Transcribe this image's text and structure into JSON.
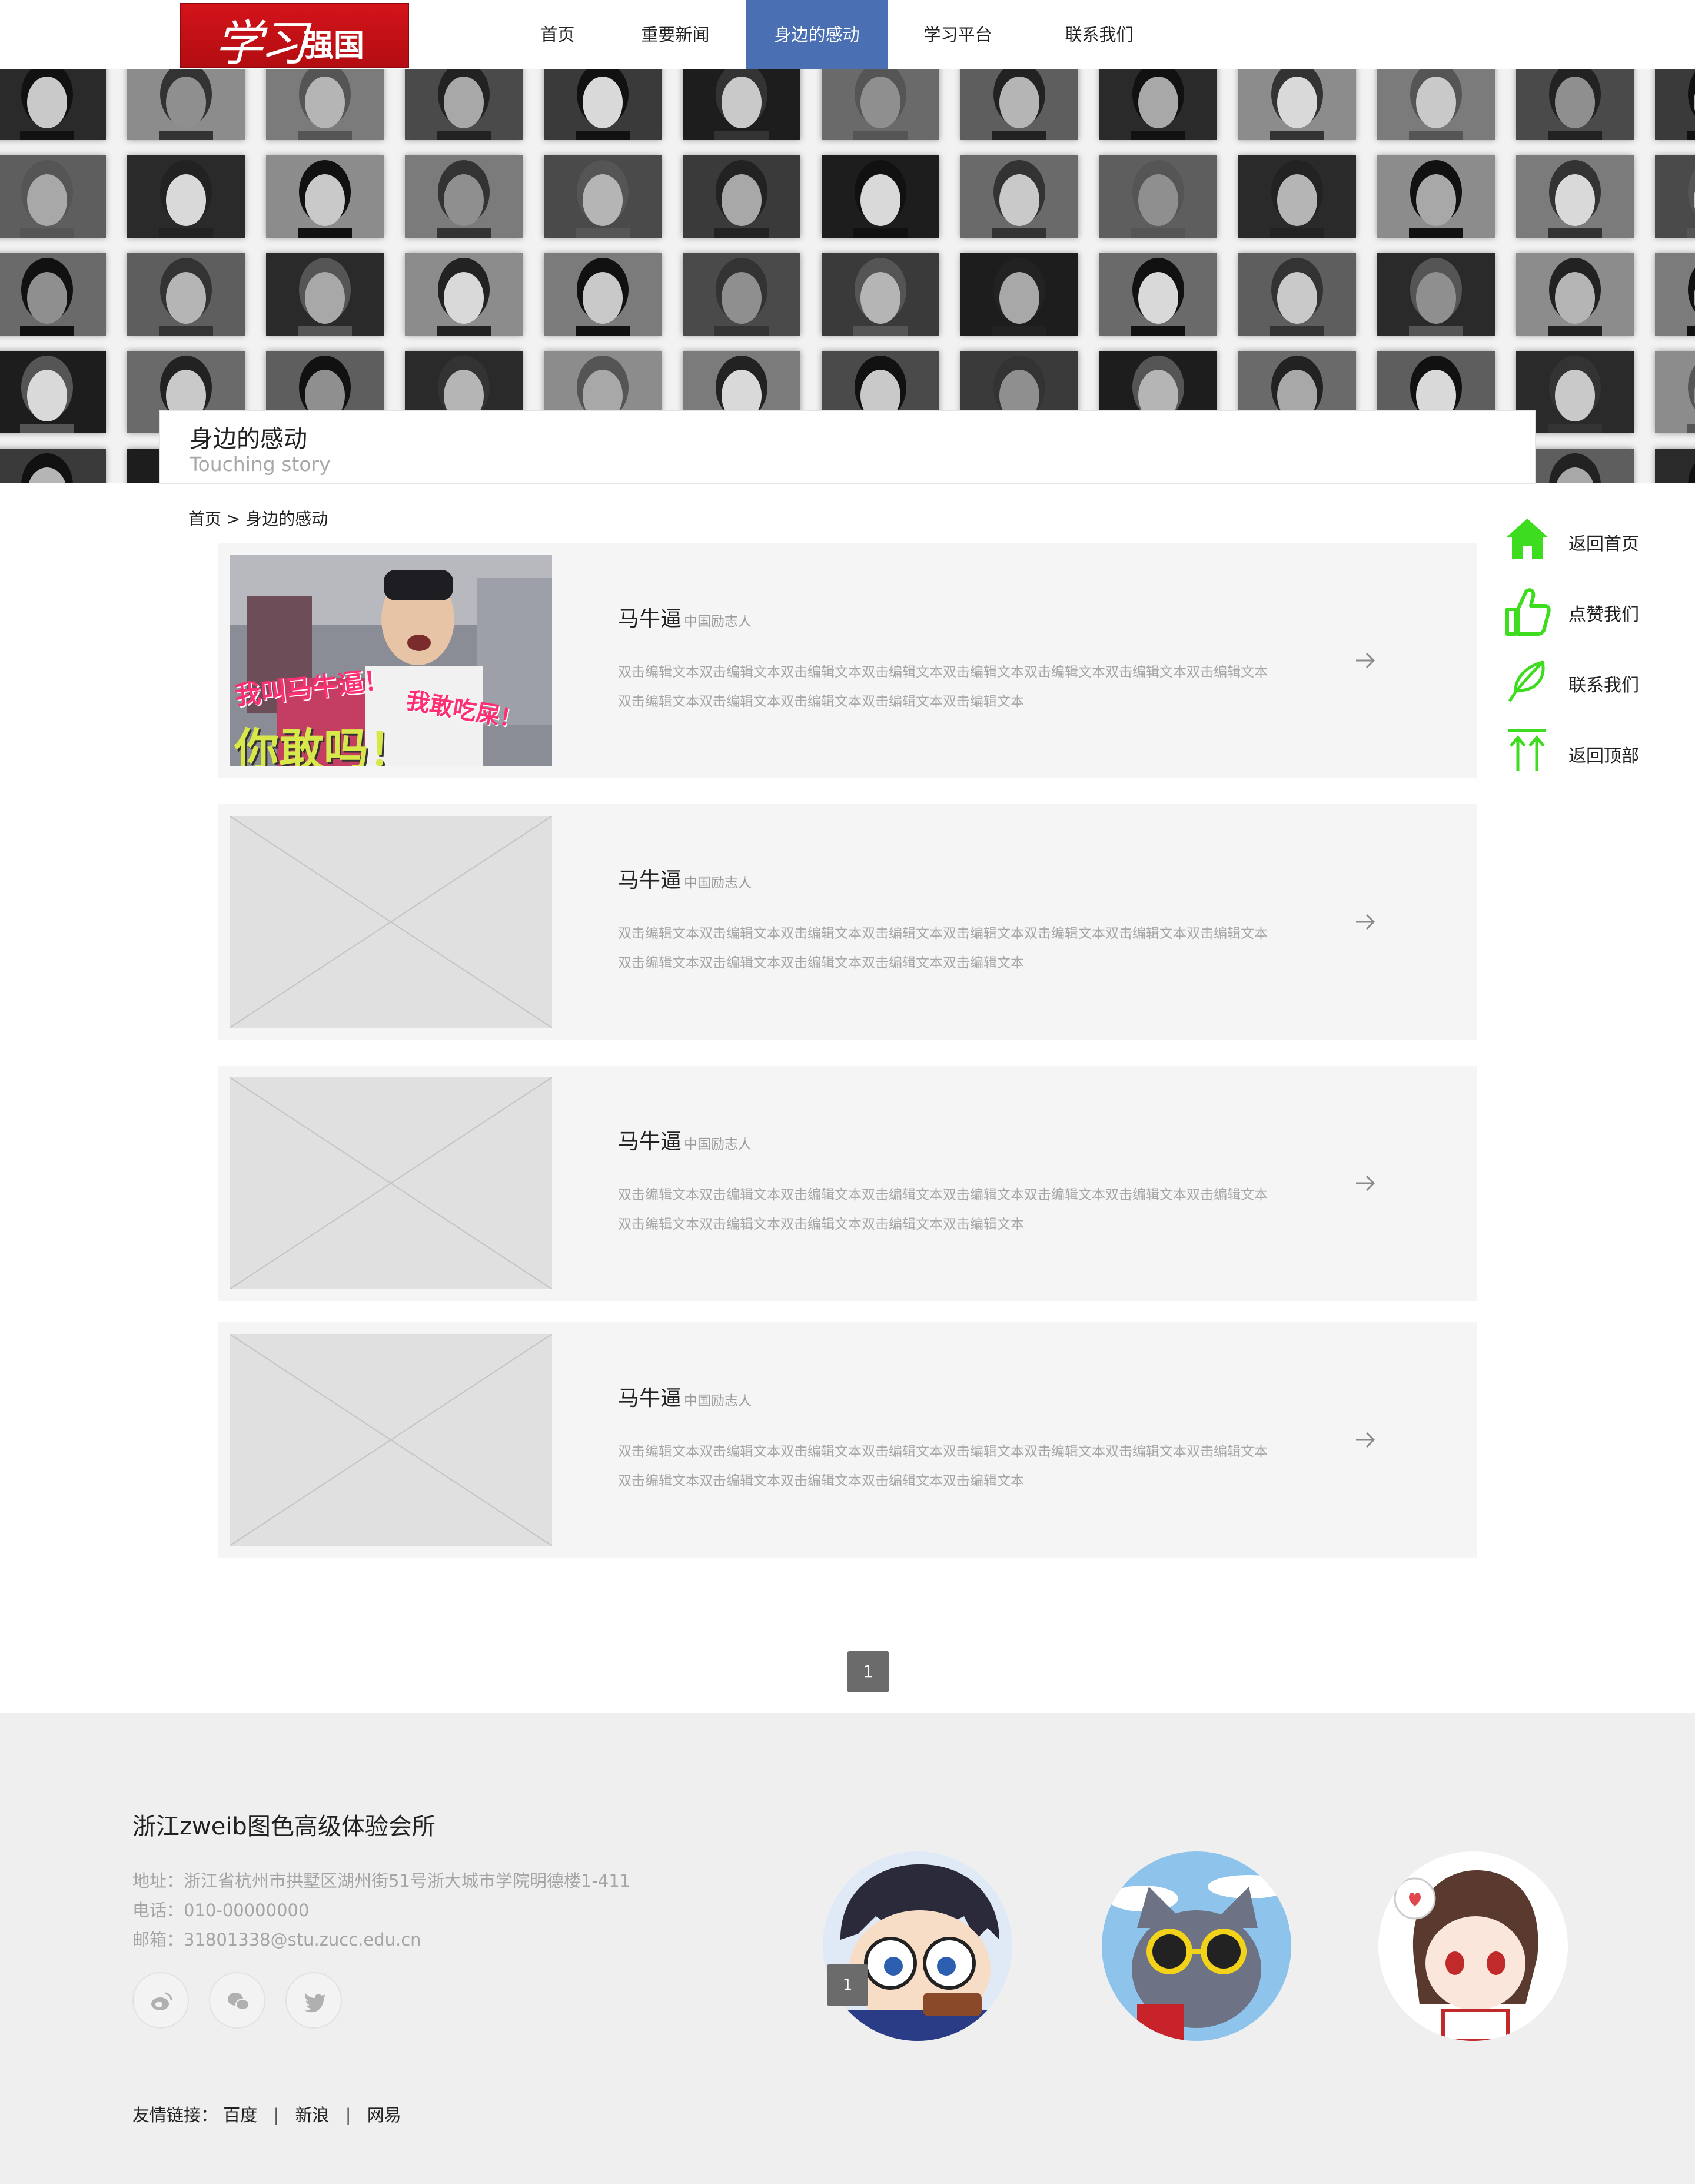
{
  "header": {
    "logo": {
      "text_a": "学习",
      "text_b": "强国"
    },
    "nav": [
      {
        "label": "首页"
      },
      {
        "label": "重要新闻"
      },
      {
        "label": "身边的感动",
        "active": true
      },
      {
        "label": "学习平台"
      },
      {
        "label": "联系我们"
      }
    ],
    "active_color": "#4a6fb3"
  },
  "banner": {
    "title": "身边的感动",
    "subtitle": "Touching story"
  },
  "breadcrumb": {
    "home": "首页",
    "separator": ">",
    "current": "身边的感动"
  },
  "cards": [
    {
      "name": "马牛逼",
      "tag": "中国励志人",
      "desc": "双击编辑文本双击编辑文本双击编辑文本双击编辑文本双击编辑文本双击编辑文本双击编辑文本双击编辑文本双击编辑文本双击编辑文本双击编辑文本双击编辑文本双击编辑文本",
      "image": "meme-photo",
      "image_caption": {
        "line1": "我叫马牛逼！",
        "line2": "我敢吃屎！",
        "line3": "你敢吗！"
      }
    },
    {
      "name": "马牛逼",
      "tag": "中国励志人",
      "desc": "双击编辑文本双击编辑文本双击编辑文本双击编辑文本双击编辑文本双击编辑文本双击编辑文本双击编辑文本双击编辑文本双击编辑文本双击编辑文本双击编辑文本双击编辑文本",
      "image": "placeholder"
    },
    {
      "name": "马牛逼",
      "tag": "中国励志人",
      "desc": "双击编辑文本双击编辑文本双击编辑文本双击编辑文本双击编辑文本双击编辑文本双击编辑文本双击编辑文本双击编辑文本双击编辑文本双击编辑文本双击编辑文本双击编辑文本",
      "image": "placeholder"
    },
    {
      "name": "马牛逼",
      "tag": "中国励志人",
      "desc": "双击编辑文本双击编辑文本双击编辑文本双击编辑文本双击编辑文本双击编辑文本双击编辑文本双击编辑文本双击编辑文本双击编辑文本双击编辑文本双击编辑文本双击编辑文本",
      "image": "placeholder"
    }
  ],
  "side_menu": [
    {
      "label": "返回首页",
      "icon": "home-icon"
    },
    {
      "label": "点赞我们",
      "icon": "thumbs-up-icon"
    },
    {
      "label": "联系我们",
      "icon": "feather-icon"
    },
    {
      "label": "返回顶部",
      "icon": "back-to-top-icon"
    }
  ],
  "side_icon_color": "#3ddc1f",
  "pagination": {
    "current": "1"
  },
  "footer": {
    "org_name": "浙江zweib图色高级体验会所",
    "address": "地址：浙江省杭州市拱墅区湖州街51号浙大城市学院明德楼1-411",
    "phone": "电话：010-00000000",
    "email": "邮箱：31801338@stu.zucc.edu.cn",
    "social": [
      "weibo-icon",
      "wechat-icon",
      "twitter-icon"
    ],
    "avatars": [
      "anime-boy-avatar",
      "cat-avatar",
      "anime-girl-avatar"
    ],
    "avatar_badge": "1",
    "links_label": "友情链接：",
    "links": [
      "百度",
      "新浪",
      "网易"
    ],
    "links_separator": "|"
  }
}
